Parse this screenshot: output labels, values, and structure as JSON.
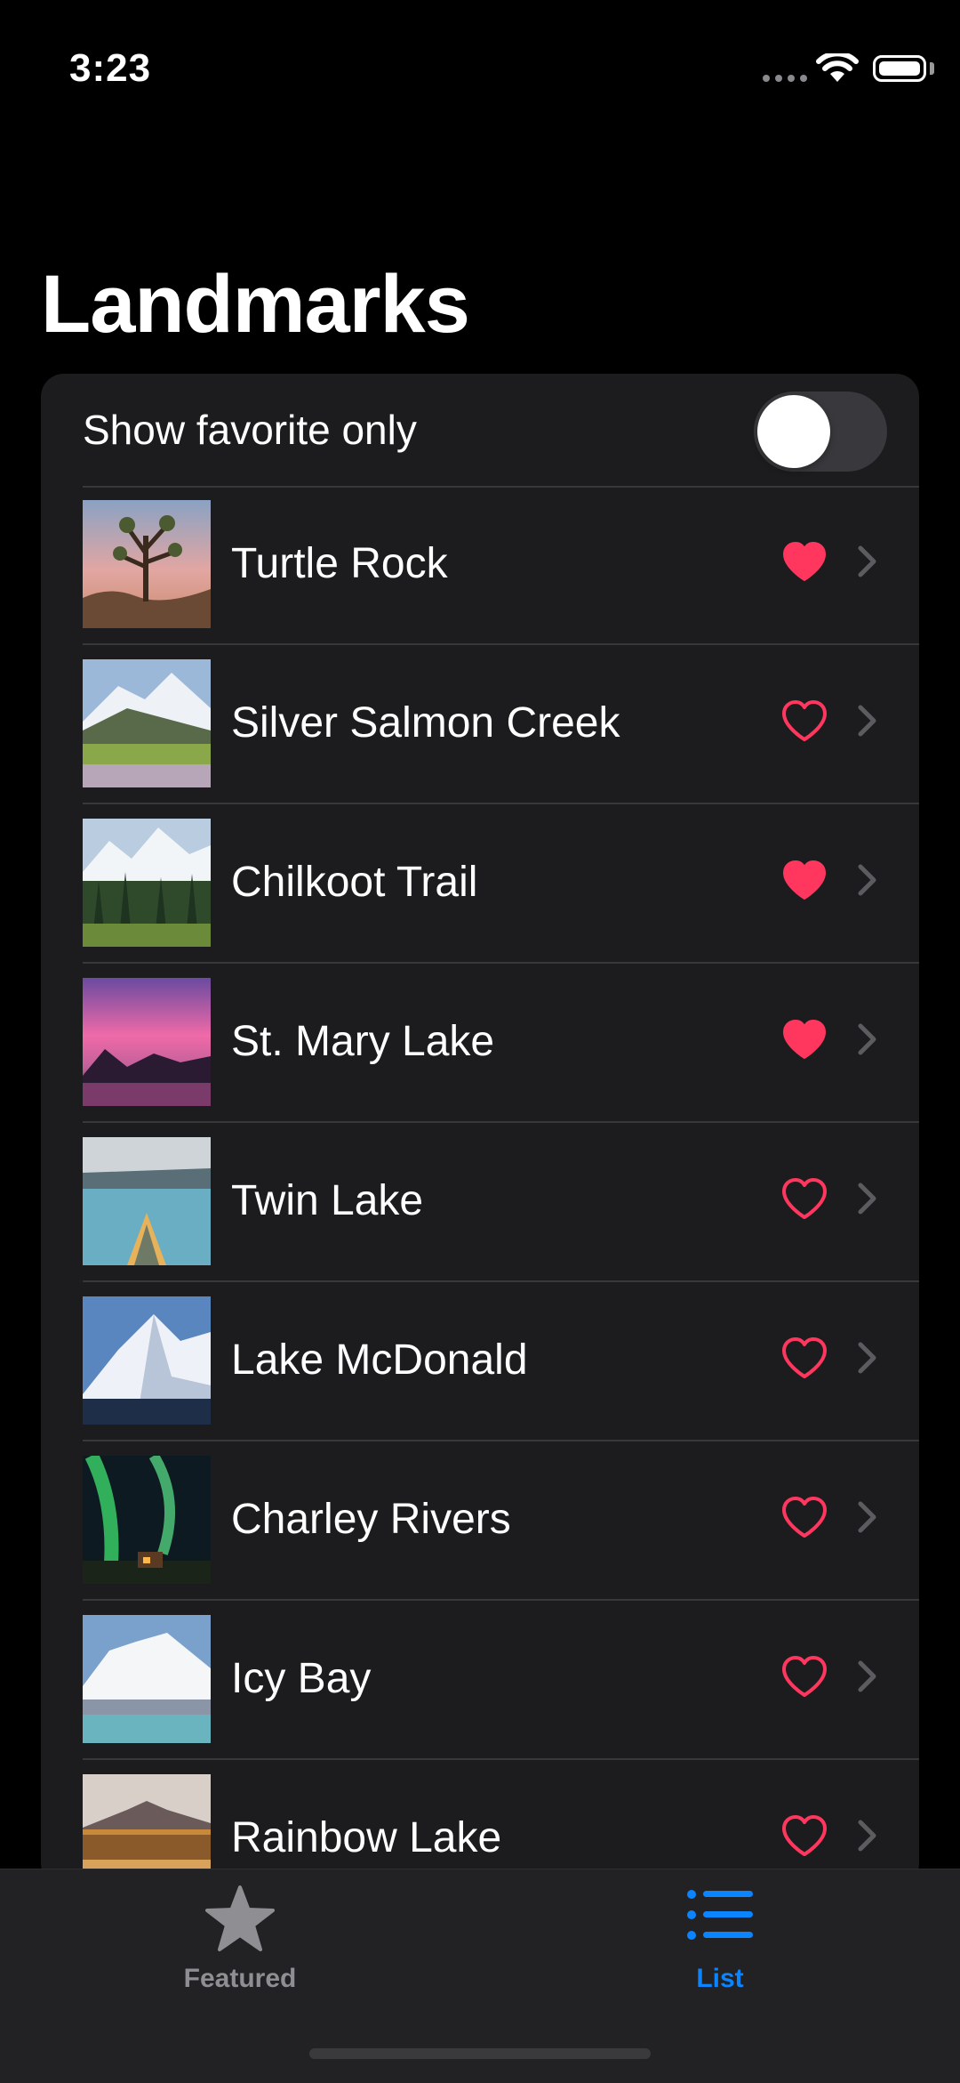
{
  "status_bar": {
    "time": "3:23"
  },
  "nav": {
    "title": "Landmarks"
  },
  "filter": {
    "label": "Show favorite only",
    "enabled": false
  },
  "landmarks": [
    {
      "name": "Turtle Rock",
      "favorite": true
    },
    {
      "name": "Silver Salmon Creek",
      "favorite": false
    },
    {
      "name": "Chilkoot Trail",
      "favorite": true
    },
    {
      "name": "St. Mary Lake",
      "favorite": true
    },
    {
      "name": "Twin Lake",
      "favorite": false
    },
    {
      "name": "Lake McDonald",
      "favorite": false
    },
    {
      "name": "Charley Rivers",
      "favorite": false
    },
    {
      "name": "Icy Bay",
      "favorite": false
    },
    {
      "name": "Rainbow Lake",
      "favorite": false
    }
  ],
  "tabs": [
    {
      "label": "Featured",
      "icon": "star-icon",
      "selected": false
    },
    {
      "label": "List",
      "icon": "list-icon",
      "selected": true
    }
  ],
  "colors": {
    "accent": "#0a84ff",
    "favorite": "#ff375f",
    "inactive_tab": "#8e8e93",
    "chevron": "#5b5b60"
  }
}
